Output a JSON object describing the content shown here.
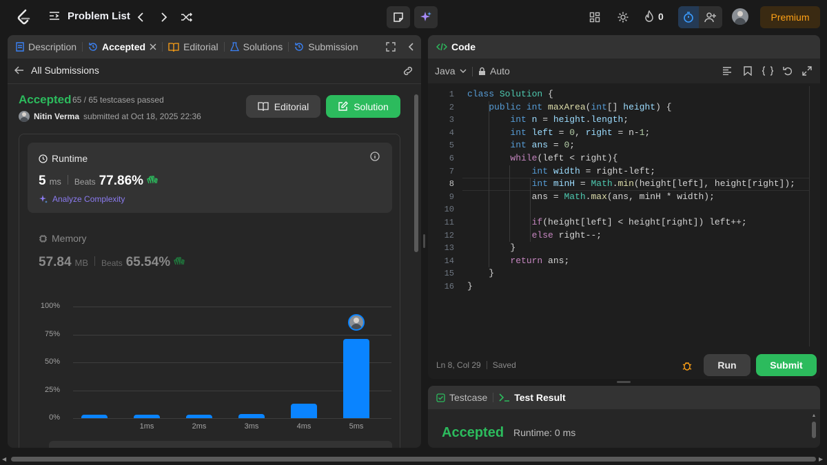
{
  "topbar": {
    "problem_list_label": "Problem List",
    "streak_count": "0",
    "premium_label": "Premium"
  },
  "left_panel": {
    "tabs": [
      "Description",
      "Accepted",
      "Editorial",
      "Solutions",
      "Submission"
    ],
    "back_label": "All Submissions",
    "status": "Accepted",
    "testcases": "65 / 65 testcases passed",
    "user_name": "Nitin Verma",
    "submitted_text": "submitted at Oct 18, 2025 22:36",
    "editorial_button": "Editorial",
    "solution_button": "Solution",
    "runtime": {
      "title": "Runtime",
      "value": "5",
      "unit": "ms",
      "beats_label": "Beats",
      "beats_value": "77.86%",
      "analyze_label": "Analyze Complexity"
    },
    "memory": {
      "title": "Memory",
      "value": "57.84",
      "unit": "MB",
      "beats_label": "Beats",
      "beats_value": "65.54%"
    }
  },
  "chart_data": {
    "type": "bar",
    "categories": [
      "",
      "1ms",
      "2ms",
      "3ms",
      "4ms",
      "5ms"
    ],
    "values": [
      3,
      3,
      3,
      3.5,
      13,
      71
    ],
    "ylim": [
      0,
      100
    ],
    "yticks": [
      "100%",
      "75%",
      "50%",
      "25%",
      "0%"
    ],
    "xlabel": "",
    "ylabel": "",
    "highlight_index": 5,
    "bar_color": "#0a84ff",
    "grid": true
  },
  "editor": {
    "title": "Code",
    "language": "Java",
    "mode": "Auto",
    "line_count": [
      "1",
      "2",
      "3",
      "4",
      "5",
      "6",
      "7",
      "8",
      "9",
      "10",
      "11",
      "12",
      "13",
      "14",
      "15",
      "16"
    ],
    "cursor_pos": "Ln 8, Col 29",
    "save_status": "Saved",
    "run_label": "Run",
    "submit_label": "Submit"
  },
  "result_panel": {
    "testcase_tab": "Testcase",
    "result_tab": "Test Result",
    "status": "Accepted",
    "runtime": "Runtime: 0 ms"
  },
  "colors": {
    "accent_green": "#2cbb5d",
    "accent_orange": "#ffa116",
    "accent_blue": "#0a84ff"
  }
}
